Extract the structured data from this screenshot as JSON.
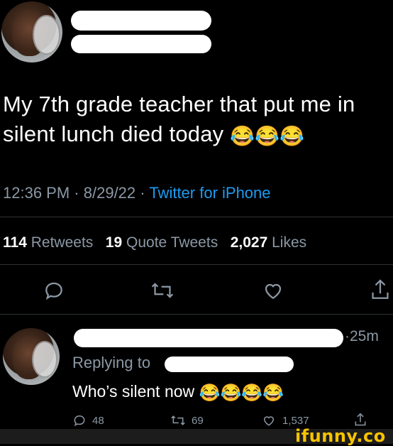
{
  "tweet": {
    "text": "My 7th grade teacher that put me in silent lunch died today",
    "emojis": [
      "😂",
      "😂",
      "😂"
    ],
    "time": "12:36 PM",
    "date": "8/29/22",
    "source": "Twitter for iPhone",
    "separator": "·"
  },
  "stats": {
    "retweets_count": "114",
    "retweets_label": "Retweets",
    "quotes_count": "19",
    "quotes_label": "Quote Tweets",
    "likes_count": "2,027",
    "likes_label": "Likes"
  },
  "actions": {
    "reply_icon": "reply-icon",
    "retweet_icon": "retweet-icon",
    "like_icon": "heart-icon",
    "share_icon": "share-icon"
  },
  "reply": {
    "age": "25m",
    "replying_to": "Replying to",
    "text": "Who’s silent now",
    "emojis": [
      "😂",
      "😂",
      "😂",
      "😂"
    ],
    "reply_count": "48",
    "retweet_count": "69",
    "like_count": "1,537"
  },
  "watermark": {
    "text": "ifunny.co"
  },
  "colors": {
    "background": "#000000",
    "link": "#1d9bf0",
    "muted": "#8b98a5",
    "watermark": "#f8c300"
  }
}
